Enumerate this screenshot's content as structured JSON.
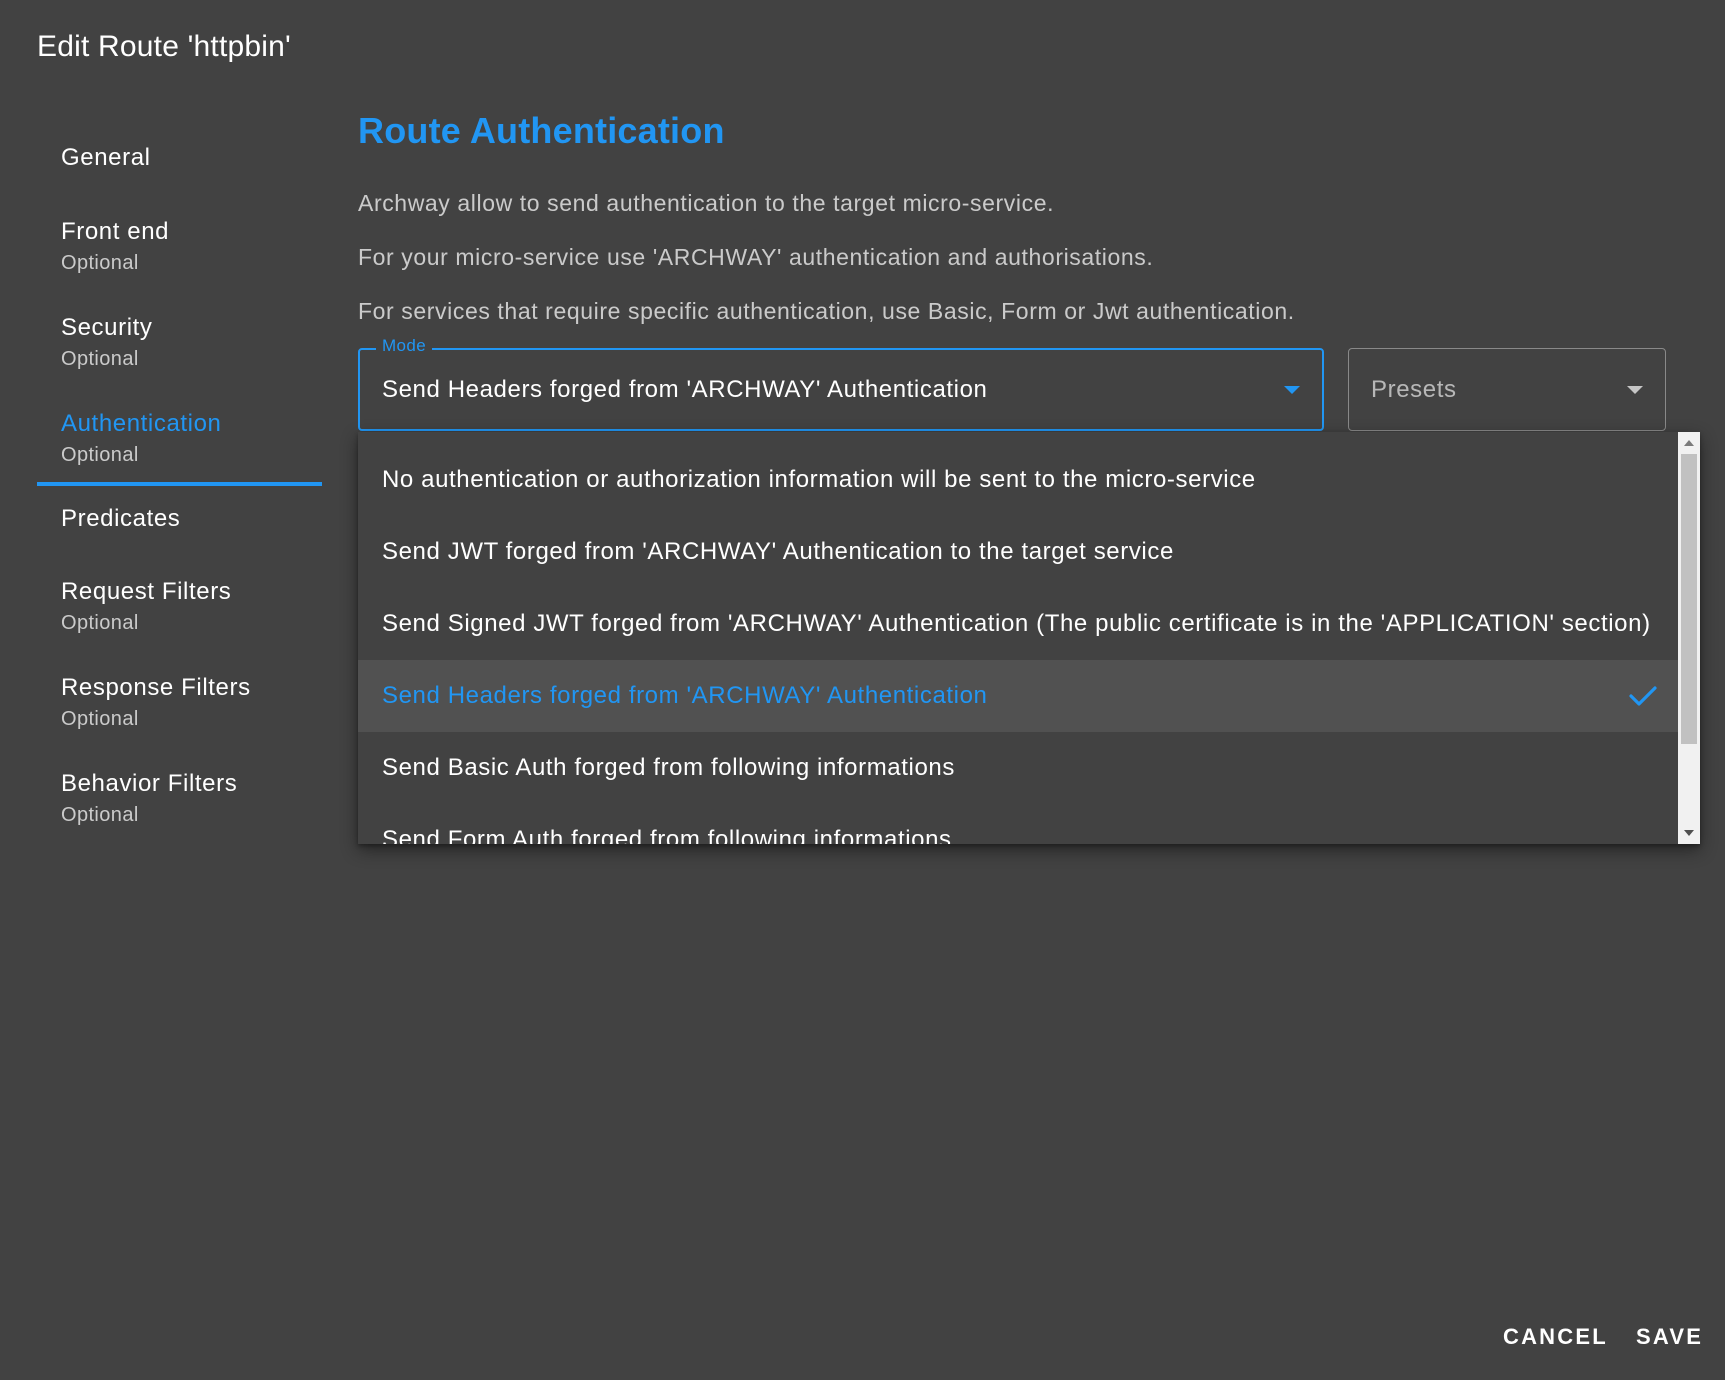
{
  "dialog": {
    "title": "Edit Route 'httpbin'"
  },
  "sidebar": {
    "items": [
      {
        "label": "General",
        "sub": ""
      },
      {
        "label": "Front end",
        "sub": "Optional"
      },
      {
        "label": "Security",
        "sub": "Optional"
      },
      {
        "label": "Authentication",
        "sub": "Optional",
        "active": true
      },
      {
        "label": "Predicates",
        "sub": ""
      },
      {
        "label": "Request Filters",
        "sub": "Optional"
      },
      {
        "label": "Response Filters",
        "sub": "Optional"
      },
      {
        "label": "Behavior Filters",
        "sub": "Optional"
      }
    ]
  },
  "main": {
    "title": "Route Authentication",
    "paragraphs": [
      "Archway allow to send authentication to the target micro-service.",
      "For your micro-service use 'ARCHWAY' authentication and authorisations.",
      "For services that require specific authentication, use Basic, Form or Jwt authentication."
    ]
  },
  "mode_field": {
    "legend": "Mode",
    "value": "Send Headers forged from 'ARCHWAY' Authentication"
  },
  "presets_field": {
    "placeholder": "Presets"
  },
  "dropdown": {
    "options": [
      "No authentication or authorization information will be sent to the micro-service",
      "Send JWT forged from 'ARCHWAY' Authentication to the target service",
      "Send Signed JWT forged from 'ARCHWAY' Authentication (The public certificate is in the 'APPLICATION' section)",
      "Send Headers forged from 'ARCHWAY' Authentication",
      "Send Basic Auth forged from following informations",
      "Send Form Auth forged from following informations"
    ],
    "selected_index": 3
  },
  "actions": {
    "cancel": "CANCEL",
    "save": "SAVE"
  },
  "colors": {
    "background": "#424242",
    "accent": "#2196f3",
    "selected_row": "#515151"
  },
  "icons": {
    "mode_caret": "caret-down-icon",
    "presets_caret": "caret-down-icon",
    "selected": "check-icon"
  }
}
